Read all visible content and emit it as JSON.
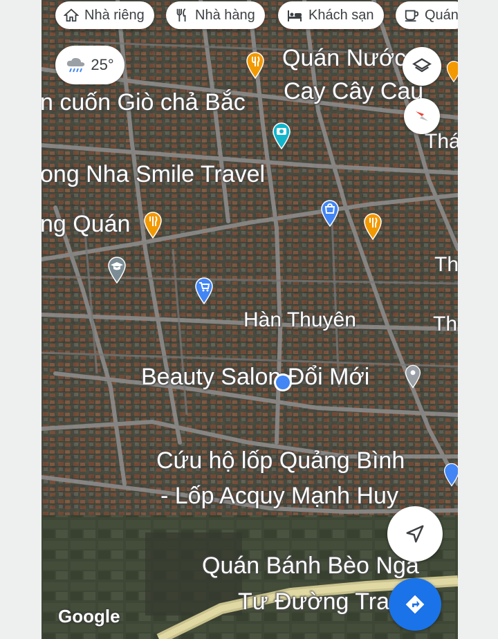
{
  "chips": [
    {
      "label": "Nhà riêng",
      "icon": "home-icon"
    },
    {
      "label": "Nhà hàng",
      "icon": "restaurant-icon"
    },
    {
      "label": "Khách sạn",
      "icon": "hotel-icon"
    },
    {
      "label": "Quán",
      "icon": "cafe-icon"
    }
  ],
  "weather": {
    "temperature": "25°",
    "icon": "rain-cloud-icon"
  },
  "map_labels": {
    "quan_nuoc": "Quán Nước",
    "cay_cay_cau": "Cay Cây Cau",
    "cuon_gio_cha": "n cuốn Giò chả Bắc",
    "thac": "Thác",
    "phong_nha": "ong Nha Smile Travel",
    "quan_left": "ng Quán",
    "th1": "Th",
    "han_thuyen": "Hàn Thuyên",
    "th2": "Th",
    "beauty_salon": "Beauty Salon Đổi Mới",
    "cuu_ho": "Cứu hộ lốp Quảng Bình",
    "lop_acquy": "- Lốp Acquy Mạnh Huy",
    "banh_beo": "Quán Bánh Bèo Ngã",
    "tu_duong": "Tư Đường Tra"
  },
  "branding": {
    "google": "Google"
  },
  "colors": {
    "accent_blue": "#1a73e8",
    "restaurant_pin": "#f29900",
    "shop_pin": "#4285f4",
    "attraction_pin": "#12b5cb",
    "location_dot": "#4285f4"
  },
  "controls": {
    "layers": "layers-icon",
    "compass": "compass-icon",
    "my_location": "navigation-arrow-icon",
    "directions": "directions-icon"
  }
}
